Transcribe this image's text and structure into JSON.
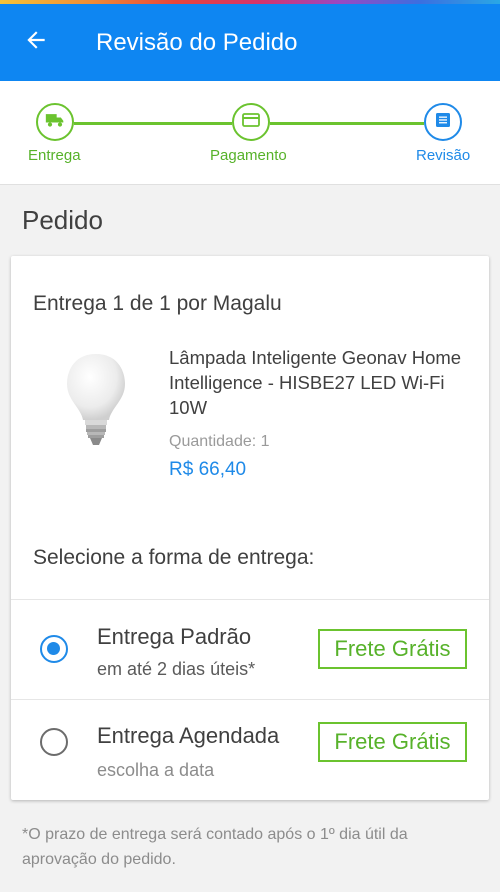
{
  "colors": {
    "header": "#0e86f2",
    "accent_blue": "#1f8ae8",
    "green": "#6bc32f"
  },
  "header": {
    "title": "Revisão do Pedido",
    "back_icon": "arrow-left-icon"
  },
  "steps": [
    {
      "label": "Entrega",
      "icon": "truck-icon",
      "state": "done"
    },
    {
      "label": "Pagamento",
      "icon": "credit-card-icon",
      "state": "done"
    },
    {
      "label": "Revisão",
      "icon": "receipt-list-icon",
      "state": "current"
    }
  ],
  "order": {
    "section_title": "Pedido",
    "shipment_title": "Entrega 1 de 1 por Magalu",
    "product": {
      "name": "Lâmpada Inteligente Geonav Home Intelligence - HISBE27 LED Wi-Fi 10W",
      "quantity_label": "Quantidade:",
      "quantity": "1",
      "price": "R$ 66,40"
    },
    "delivery_title": "Selecione a forma de entrega:",
    "options": [
      {
        "name": "Entrega Padrão",
        "subtitle": "em até 2 dias úteis*",
        "badge": "Frete Grátis",
        "selected": true
      },
      {
        "name": "Entrega Agendada",
        "subtitle": "escolha a data",
        "badge": "Frete Grátis",
        "selected": false
      }
    ]
  },
  "footnote": "*O prazo de entrega será contado após o 1º dia útil da aprovação do pedido."
}
